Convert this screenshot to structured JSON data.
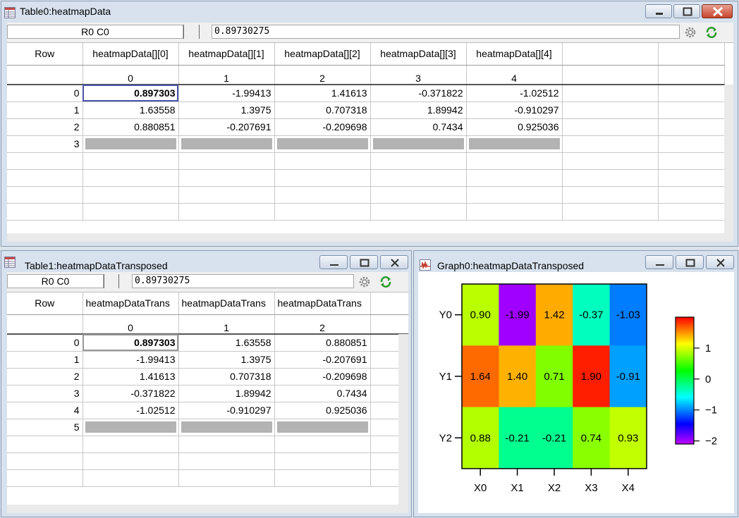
{
  "table0": {
    "title": "Table0:heatmapData",
    "cell_ref": "R0 C0",
    "value": "0.89730275",
    "row_header": "Row",
    "columns": [
      "heatmapData[][0]",
      "heatmapData[][1]",
      "heatmapData[][2]",
      "heatmapData[][3]",
      "heatmapData[][4]"
    ],
    "indices": [
      "0",
      "1",
      "2",
      "3",
      "4"
    ],
    "rows": [
      {
        "label": "0",
        "cells": [
          "0.897303",
          "-1.99413",
          "1.41613",
          "-0.371822",
          "-1.02512"
        ]
      },
      {
        "label": "1",
        "cells": [
          "1.63558",
          "1.3975",
          "0.707318",
          "1.89942",
          "-0.910297"
        ]
      },
      {
        "label": "2",
        "cells": [
          "0.880851",
          "-0.207691",
          "-0.209698",
          "0.7434",
          "0.925036"
        ]
      },
      {
        "label": "3",
        "cells": [
          "",
          "",
          "",
          "",
          ""
        ]
      }
    ]
  },
  "table1": {
    "title": "Table1:heatmapDataTransposed",
    "cell_ref": "R0 C0",
    "value": "0.89730275",
    "row_header": "Row",
    "columns": [
      "heatmapDataTrans",
      "heatmapDataTrans",
      "heatmapDataTrans"
    ],
    "indices": [
      "0",
      "1",
      "2"
    ],
    "rows": [
      {
        "label": "0",
        "cells": [
          "0.897303",
          "1.63558",
          "0.880851"
        ]
      },
      {
        "label": "1",
        "cells": [
          "-1.99413",
          "1.3975",
          "-0.207691"
        ]
      },
      {
        "label": "2",
        "cells": [
          "1.41613",
          "0.707318",
          "-0.209698"
        ]
      },
      {
        "label": "3",
        "cells": [
          "-0.371822",
          "1.89942",
          "0.7434"
        ]
      },
      {
        "label": "4",
        "cells": [
          "-1.02512",
          "-0.910297",
          "0.925036"
        ]
      },
      {
        "label": "5",
        "cells": [
          "",
          "",
          ""
        ]
      }
    ]
  },
  "graph0": {
    "title": "Graph0:heatmapDataTransposed"
  },
  "icons": {
    "table_icon": "table-icon",
    "graph_icon": "graph-icon",
    "settings": "gear-icon",
    "refresh": "refresh-icon"
  },
  "colors": {
    "selection_outline": "#4a55a8",
    "empty_row_bar": "#b3b3b3"
  },
  "chart_data": {
    "type": "heatmap",
    "x_categories": [
      "X0",
      "X1",
      "X2",
      "X3",
      "X4"
    ],
    "y_categories": [
      "Y0",
      "Y1",
      "Y2"
    ],
    "values": [
      [
        0.9,
        -1.99,
        1.42,
        -0.37,
        -1.03
      ],
      [
        1.64,
        1.4,
        0.71,
        1.9,
        -0.91
      ],
      [
        0.88,
        -0.21,
        -0.21,
        0.74,
        0.93
      ]
    ],
    "cell_labels": [
      [
        "0.90",
        "-1.99",
        "1.42",
        "-0.37",
        "-1.03"
      ],
      [
        "1.64",
        "1.40",
        "0.71",
        "1.90",
        "-0.91"
      ],
      [
        "0.88",
        "-0.21",
        "-0.21",
        "0.74",
        "0.93"
      ]
    ],
    "colorbar": {
      "range": [
        -2.1,
        2.0
      ],
      "ticks": [
        1,
        0,
        -1,
        -2
      ],
      "tick_labels": [
        "1",
        "0",
        "−1",
        "−2"
      ],
      "colormap": "rainbow"
    },
    "title": "",
    "xlabel": "",
    "ylabel": ""
  }
}
